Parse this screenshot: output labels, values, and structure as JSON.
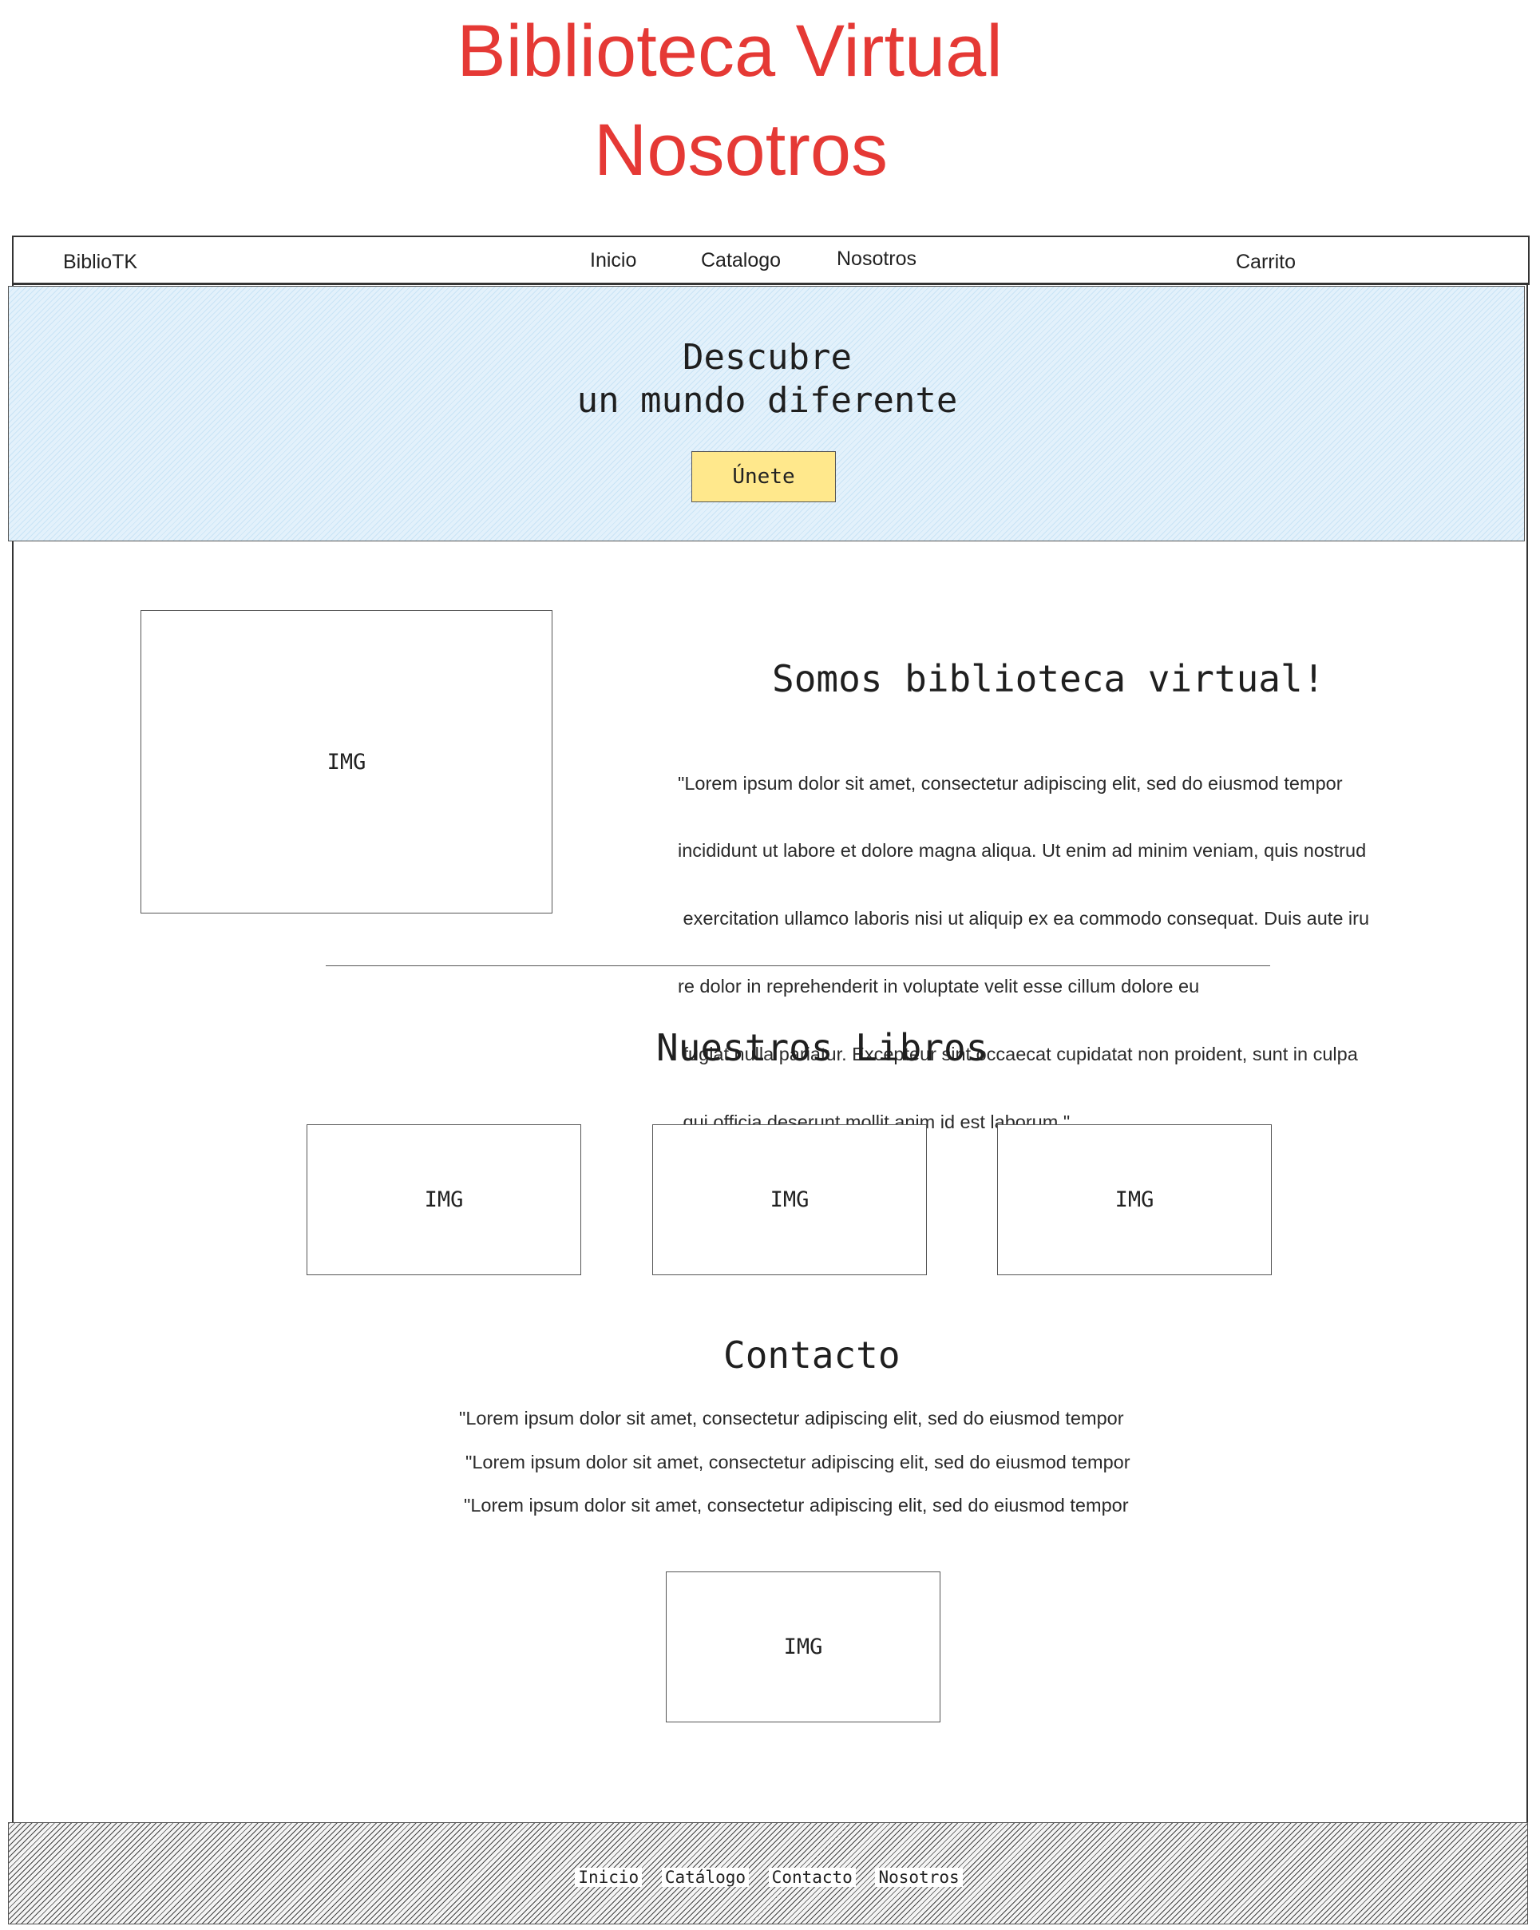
{
  "page": {
    "title_line1": "Biblioteca Virtual",
    "title_line2": "Nosotros",
    "title_color": "#e53935"
  },
  "navbar": {
    "brand": "BiblioTK",
    "links": [
      "Inicio",
      "Catalogo",
      "Nosotros"
    ],
    "cart": "Carrito"
  },
  "hero": {
    "heading_line1": "Descubre",
    "heading_line2": "un mundo diferente",
    "button_label": "Únete",
    "background_color": "#e3f1fb",
    "button_color": "#ffe88c"
  },
  "about": {
    "image_label": "IMG",
    "heading": "Somos biblioteca virtual!",
    "text_lines": [
      "\"Lorem ipsum dolor sit amet, consectetur adipiscing elit, sed do eiusmod tempor",
      "incididunt ut labore et dolore magna aliqua. Ut enim ad minim veniam, quis nostrud",
      " exercitation ullamco laboris nisi ut aliquip ex ea commodo consequat. Duis aute iru",
      "re dolor in reprehenderit in voluptate velit esse cillum dolore eu",
      " fugiat nulla pariatur. Excepteur sint occaecat cupidatat non proident, sunt in culpa",
      " qui officia deserunt mollit anim id est laborum.\""
    ]
  },
  "books": {
    "heading": "Nuestros Libros",
    "items": [
      "IMG",
      "IMG",
      "IMG"
    ]
  },
  "contact": {
    "heading": "Contacto",
    "lines": [
      "\"Lorem ipsum dolor sit amet, consectetur adipiscing elit, sed do eiusmod tempor",
      "\"Lorem ipsum dolor sit amet, consectetur adipiscing elit, sed do eiusmod tempor",
      "\"Lorem ipsum dolor sit amet, consectetur adipiscing elit, sed do eiusmod tempor"
    ],
    "image_label": "IMG"
  },
  "footer": {
    "links": [
      "Inicio",
      "Catálogo",
      "Contacto",
      "Nosotros"
    ]
  }
}
